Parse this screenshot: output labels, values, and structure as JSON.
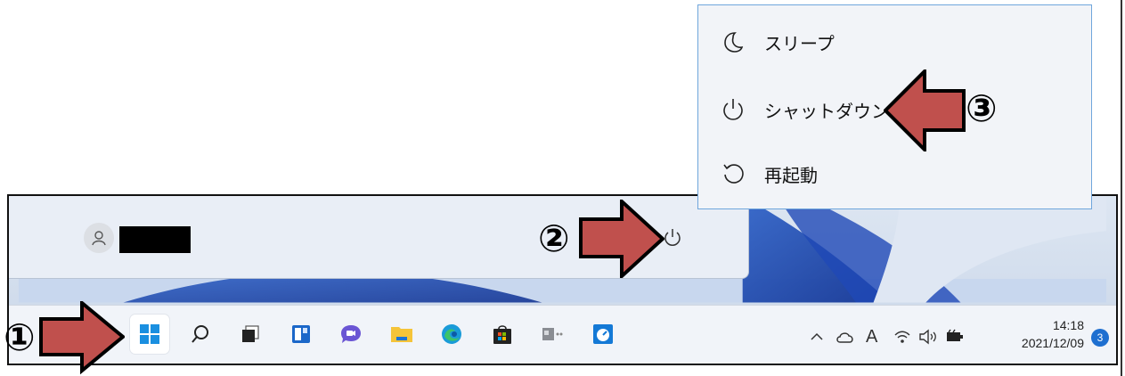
{
  "power_menu": {
    "items": [
      {
        "label": "スリープ",
        "icon": "moon-icon"
      },
      {
        "label": "シャットダウン",
        "icon": "power-icon"
      },
      {
        "label": "再起動",
        "icon": "restart-icon"
      }
    ]
  },
  "start_menu": {
    "user_name": "",
    "power_button_icon": "power-icon"
  },
  "taskbar": {
    "apps": [
      {
        "name": "start",
        "icon": "windows-logo-icon"
      },
      {
        "name": "search",
        "icon": "search-icon"
      },
      {
        "name": "task-view",
        "icon": "task-view-icon"
      },
      {
        "name": "widgets",
        "icon": "widgets-icon"
      },
      {
        "name": "chat",
        "icon": "teams-chat-icon"
      },
      {
        "name": "file-explorer",
        "icon": "folder-icon"
      },
      {
        "name": "edge",
        "icon": "edge-icon"
      },
      {
        "name": "store",
        "icon": "store-icon"
      },
      {
        "name": "app-7",
        "icon": "app-icon"
      },
      {
        "name": "app-8",
        "icon": "speedometer-icon"
      }
    ],
    "tray": {
      "ime_indicator": "A",
      "time": "14:18",
      "date": "2021/12/09",
      "notification_count": "3"
    }
  },
  "callouts": {
    "one": "①",
    "two": "②",
    "three": "③",
    "color": "#c0504d"
  }
}
